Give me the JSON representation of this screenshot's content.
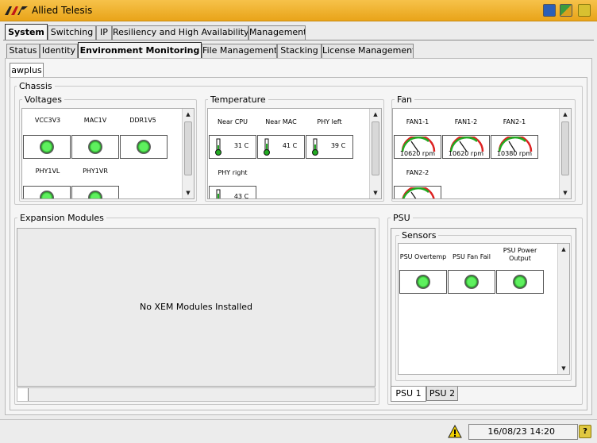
{
  "window": {
    "title": "Allied Telesis"
  },
  "main_tabs": [
    {
      "label": "System",
      "active": true
    },
    {
      "label": "Switching"
    },
    {
      "label": "IP"
    },
    {
      "label": "Resiliency and High Availability"
    },
    {
      "label": "Management"
    }
  ],
  "sub_tabs": [
    {
      "label": "Status"
    },
    {
      "label": "Identity"
    },
    {
      "label": "Environment Monitoring",
      "active": true
    },
    {
      "label": "File Management"
    },
    {
      "label": "Stacking"
    },
    {
      "label": "License Management"
    }
  ],
  "device_tab": "awplus",
  "chassis": {
    "label": "Chassis",
    "voltages": {
      "label": "Voltages",
      "items": [
        "VCC3V3",
        "MAC1V",
        "DDR1V5",
        "PHY1VL",
        "PHY1VR"
      ]
    },
    "temperature": {
      "label": "Temperature",
      "items": [
        {
          "name": "Near CPU",
          "value": "31 C"
        },
        {
          "name": "Near MAC",
          "value": "41 C"
        },
        {
          "name": "PHY left",
          "value": "39 C"
        },
        {
          "name": "PHY right",
          "value": "43 C"
        }
      ]
    },
    "fan": {
      "label": "Fan",
      "items": [
        {
          "name": "FAN1-1",
          "value": "10620 rpm"
        },
        {
          "name": "FAN1-2",
          "value": "10620 rpm"
        },
        {
          "name": "FAN2-1",
          "value": "10380 rpm"
        },
        {
          "name": "FAN2-2",
          "value": ""
        }
      ]
    }
  },
  "expansion": {
    "label": "Expansion Modules",
    "message": "No XEM Modules Installed"
  },
  "psu": {
    "label": "PSU",
    "sensors_label": "Sensors",
    "sensors": [
      "PSU Overtemp",
      "PSU Fan Fail",
      "PSU Power Output"
    ],
    "tabs": [
      {
        "label": "PSU 1",
        "active": true
      },
      {
        "label": "PSU 2"
      }
    ]
  },
  "status": {
    "datetime": "16/08/23 14:20"
  },
  "colors": {
    "titlebar": "#f0b431",
    "led": "#44dd44",
    "gauge_arc": "#22aa22",
    "gauge_red": "#dd2222"
  }
}
